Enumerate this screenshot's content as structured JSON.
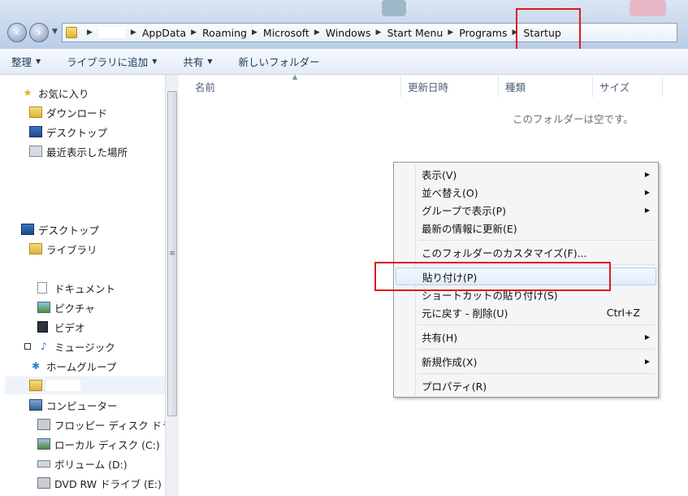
{
  "address": {
    "crumbs": [
      "",
      "AppData",
      "Roaming",
      "Microsoft",
      "Windows",
      "Start Menu",
      "Programs",
      "Startup"
    ]
  },
  "toolbar": {
    "organize": "整理",
    "add_to_library": "ライブラリに追加",
    "share": "共有",
    "new_folder": "新しいフォルダー"
  },
  "nav": {
    "favorites": "お気に入り",
    "downloads": "ダウンロード",
    "desktop_fav": "デスクトップ",
    "recent": "最近表示した場所",
    "desktop": "デスクトップ",
    "libraries": "ライブラリ",
    "documents": "ドキュメント",
    "pictures": "ピクチャ",
    "videos": "ビデオ",
    "music": "ミュージック",
    "homegroup": "ホームグループ",
    "computer": "コンピューター",
    "floppy": "フロッピー ディスク ドラ",
    "local_disk": "ローカル ディスク (C:)",
    "volume": "ボリューム (D:)",
    "dvd": "DVD RW ドライブ (E:)"
  },
  "columns": [
    "名前",
    "更新日時",
    "種類",
    "サイズ"
  ],
  "empty_message": "このフォルダーは空です。",
  "context_menu": {
    "view": "表示(V)",
    "sort": "並べ替え(O)",
    "group": "グループで表示(P)",
    "refresh": "最新の情報に更新(E)",
    "customize": "このフォルダーのカスタマイズ(F)...",
    "paste": "貼り付け(P)",
    "paste_shortcut": "ショートカットの貼り付け(S)",
    "undo": "元に戻す - 削除(U)",
    "undo_accel": "Ctrl+Z",
    "share": "共有(H)",
    "new": "新規作成(X)",
    "properties": "プロパティ(R)"
  },
  "colors": {
    "annotation": "#e0181e",
    "menu_highlight": "#e2ecfa",
    "toolbar_text": "#1e395b"
  }
}
